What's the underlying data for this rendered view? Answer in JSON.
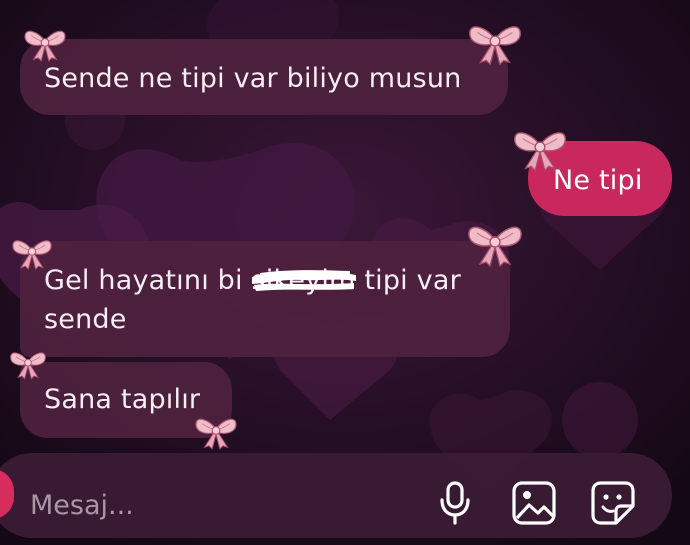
{
  "conversation": {
    "messages": [
      {
        "direction": "incoming",
        "text": "Sende ne tipi var biliyo musun"
      },
      {
        "direction": "outgoing",
        "text": "Ne tipi"
      },
      {
        "direction": "incoming",
        "line1_before": "Gel hayatını bi ",
        "line1_redacted": "sikeyim",
        "line1_after": " tipi var",
        "line2": "sende"
      },
      {
        "direction": "incoming",
        "text": "Sana tapılır"
      }
    ]
  },
  "composer": {
    "placeholder": "Mesaj..."
  },
  "icons": {
    "decoration": "pink-bow-icon",
    "composer": [
      "camera-icon",
      "microphone-icon",
      "gallery-icon",
      "sticker-icon"
    ]
  },
  "colors": {
    "background": "#1c0b1f",
    "incoming_bubble": "#4e223e",
    "outgoing_bubble": "#c8285e",
    "accent": "#d62c5e"
  }
}
